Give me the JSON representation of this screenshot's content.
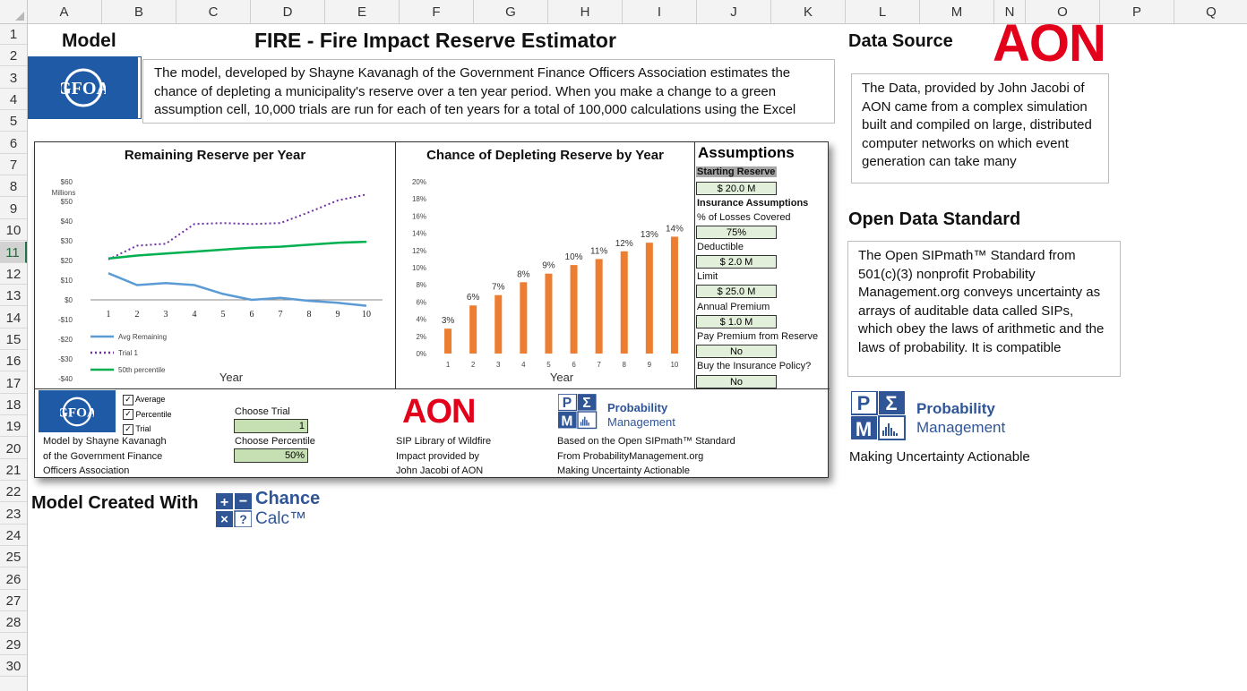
{
  "grid": {
    "columns": [
      "A",
      "B",
      "C",
      "D",
      "E",
      "F",
      "G",
      "H",
      "I",
      "J",
      "K",
      "L",
      "M",
      "N",
      "O",
      "P",
      "Q"
    ],
    "rows": [
      "1",
      "2",
      "3",
      "4",
      "5",
      "6",
      "7",
      "8",
      "9",
      "10",
      "11",
      "12",
      "13",
      "14",
      "15",
      "16",
      "17",
      "18",
      "19",
      "20",
      "21",
      "22",
      "23",
      "24",
      "25",
      "26",
      "27",
      "28",
      "29",
      "30"
    ],
    "selected_row": "11"
  },
  "header": {
    "model_label": "Model",
    "title": "FIRE - Fire Impact Reserve Estimator",
    "data_source_label": "Data Source",
    "aon_logo": "AON",
    "description": "The model, developed by Shayne Kavanagh of the Government Finance Officers Association estimates the chance of depleting a municipality's reserve over a ten year period. When you make a change to a green assumption cell, 10,000 trials are run for each of ten years for a total of 100,000 calculations using the Excel"
  },
  "side": {
    "data_source_text": "The Data, provided by John Jacobi of AON came from a complex simulation built and compiled on large, distributed computer networks on which event generation can take many",
    "open_data_title": "Open Data Standard",
    "open_data_text": "The Open SIPmath™ Standard from 501(c)(3) nonprofit Probability Management.org conveys uncertainty as arrays of auditable data called SIPs, which obey the laws of arithmetic and the laws of probability. It is compatible",
    "pm_logo_line1": "Probability",
    "pm_logo_line2": "Management",
    "pm_tagline": "Making Uncertainty Actionable"
  },
  "footer": {
    "created_with": "Model Created With",
    "cc_line1": "Chance",
    "cc_line2": "Calc™"
  },
  "chart_data": [
    {
      "type": "line",
      "title": "Remaining Reserve per Year",
      "xlabel": "Year",
      "ylabel": "Millions",
      "x": [
        1,
        2,
        3,
        4,
        5,
        6,
        7,
        8,
        9,
        10
      ],
      "ylim": [
        -40,
        60
      ],
      "yticks": [
        "$60",
        "$50",
        "$40",
        "$30",
        "$20",
        "$10",
        "$0",
        "-$10",
        "-$20",
        "-$30",
        "-$40"
      ],
      "series": [
        {
          "name": "Avg Remaining",
          "color": "#5b9bd5",
          "dash": "solid",
          "values": [
            13.5,
            7.5,
            8.5,
            7.5,
            3,
            0,
            1,
            -0.5,
            -1.5,
            -3
          ]
        },
        {
          "name": "Trial 1",
          "color": "#7030a0",
          "dash": "dotted",
          "values": [
            20.5,
            27.5,
            28.5,
            38.5,
            39,
            38.5,
            39,
            44.5,
            50.5,
            53.5
          ]
        },
        {
          "name": "50th percentile",
          "color": "#00b050",
          "dash": "solid",
          "values": [
            21,
            22.5,
            23.5,
            24.5,
            25.5,
            26.5,
            27,
            28,
            29,
            29.5
          ]
        }
      ]
    },
    {
      "type": "bar",
      "title": "Chance of Depleting Reserve by Year",
      "xlabel": "Year",
      "categories": [
        "1",
        "2",
        "3",
        "4",
        "5",
        "6",
        "7",
        "8",
        "9",
        "10"
      ],
      "values": [
        3,
        6,
        7,
        8,
        9,
        10,
        11,
        12,
        13,
        14
      ],
      "value_heights": [
        2.9,
        5.6,
        6.8,
        8.3,
        9.3,
        10.3,
        11.0,
        11.9,
        12.9,
        13.6
      ],
      "data_labels": [
        "3%",
        "6%",
        "7%",
        "8%",
        "9%",
        "10%",
        "11%",
        "12%",
        "13%",
        "14%"
      ],
      "ylim": [
        0,
        20
      ],
      "yticks": [
        "20%",
        "18%",
        "16%",
        "14%",
        "12%",
        "10%",
        "8%",
        "6%",
        "4%",
        "2%",
        "0%"
      ],
      "color": "#ed7d31"
    }
  ],
  "assumptions": {
    "title": "Assumptions",
    "starting_reserve_label": "Starting Reserve",
    "starting_reserve": "$ 20.0 M",
    "insurance_header": "Insurance Assumptions",
    "losses_label": "% of Losses Covered",
    "losses": "75%",
    "deductible_label": "Deductible",
    "deductible": "$ 2.0 M",
    "limit_label": "Limit",
    "limit": "$ 25.0 M",
    "premium_label": "Annual Premium",
    "premium": "$ 1.0 M",
    "pay_label": "Pay Premium from Reserve",
    "pay": "No",
    "buy_label": "Buy the Insurance Policy?",
    "buy": "No"
  },
  "controls": {
    "cb_average": "Average",
    "cb_percentile": "Percentile",
    "cb_trial": "Trial",
    "check": "✓",
    "choose_trial_label": "Choose Trial",
    "choose_trial": "1",
    "choose_percentile_label": "Choose Percentile",
    "choose_percentile": "50%",
    "gfoa_credit_1": "Model by Shayne Kavanagh",
    "gfoa_credit_2": "of the Government Finance",
    "gfoa_credit_3": "Officers Association",
    "aon_credit_1": "SIP Library of Wildfire",
    "aon_credit_2": "Impact provided by",
    "aon_credit_3": "John Jacobi of AON",
    "pm_credit_1": "Based on the Open SIPmath™ Standard",
    "pm_credit_2": "From ProbabilityManagement.org",
    "pm_credit_3": "Making Uncertainty Actionable"
  }
}
